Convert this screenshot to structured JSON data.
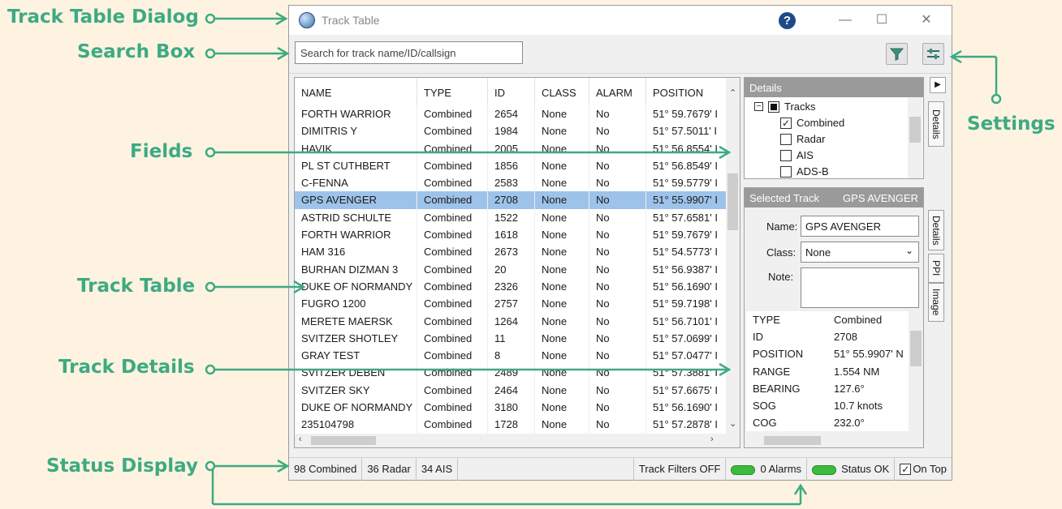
{
  "annotations": {
    "track_table_dialog": "Track Table Dialog",
    "search_box": "Search Box",
    "fields": "Fields",
    "track_table": "Track Table",
    "track_details": "Track Details",
    "status_display": "Status Display",
    "settings": "Settings"
  },
  "window": {
    "title": "Track Table",
    "help": "?",
    "minimize": "—",
    "maximize": "☐",
    "close": "✕"
  },
  "search": {
    "placeholder": "Search for track name/ID/callsign"
  },
  "table": {
    "columns": [
      "NAME",
      "TYPE",
      "ID",
      "CLASS",
      "ALARM",
      "POSITION"
    ],
    "rows": [
      [
        "FORTH WARRIOR",
        "Combined",
        "2654",
        "None",
        "No",
        "51° 59.7679' I"
      ],
      [
        "DIMITRIS Y",
        "Combined",
        "1984",
        "None",
        "No",
        "51° 57.5011' I"
      ],
      [
        "HAVIK",
        "Combined",
        "2005",
        "None",
        "No",
        "51° 56.8554' I"
      ],
      [
        "PL ST CUTHBERT",
        "Combined",
        "1856",
        "None",
        "No",
        "51° 56.8549' I"
      ],
      [
        "C-FENNA",
        "Combined",
        "2583",
        "None",
        "No",
        "51° 59.5779' I"
      ],
      [
        "GPS AVENGER",
        "Combined",
        "2708",
        "None",
        "No",
        "51° 55.9907' I"
      ],
      [
        "ASTRID SCHULTE",
        "Combined",
        "1522",
        "None",
        "No",
        "51° 57.6581' I"
      ],
      [
        "FORTH WARRIOR",
        "Combined",
        "1618",
        "None",
        "No",
        "51° 59.7679' I"
      ],
      [
        "HAM 316",
        "Combined",
        "2673",
        "None",
        "No",
        "51° 54.5773' I"
      ],
      [
        "BURHAN DIZMAN 3",
        "Combined",
        "20",
        "None",
        "No",
        "51° 56.9387' I"
      ],
      [
        "DUKE OF NORMANDY",
        "Combined",
        "2326",
        "None",
        "No",
        "51° 56.1690' I"
      ],
      [
        "FUGRO 1200",
        "Combined",
        "2757",
        "None",
        "No",
        "51° 59.7198' I"
      ],
      [
        "MERETE MAERSK",
        "Combined",
        "1264",
        "None",
        "No",
        "51° 56.7101' I"
      ],
      [
        "SVITZER SHOTLEY",
        "Combined",
        "11",
        "None",
        "No",
        "51° 57.0699' I"
      ],
      [
        "GRAY TEST",
        "Combined",
        "8",
        "None",
        "No",
        "51° 57.0477' I"
      ],
      [
        "SVITZER DEBEN",
        "Combined",
        "2489",
        "None",
        "No",
        "51° 57.3881' I"
      ],
      [
        "SVITZER SKY",
        "Combined",
        "2464",
        "None",
        "No",
        "51° 57.6675' I"
      ],
      [
        "DUKE OF NORMANDY",
        "Combined",
        "3180",
        "None",
        "No",
        "51° 56.1690' I"
      ],
      [
        "235104798",
        "Combined",
        "1728",
        "None",
        "No",
        "51° 57.2878' I"
      ]
    ],
    "selected_index": 5
  },
  "details_panel": {
    "header": "Details",
    "tree_root": "Tracks",
    "items": [
      {
        "label": "Combined",
        "checked": true
      },
      {
        "label": "Radar",
        "checked": false
      },
      {
        "label": "AIS",
        "checked": false
      },
      {
        "label": "ADS-B",
        "checked": false
      }
    ],
    "side_tab": "Details"
  },
  "selected_track": {
    "header_label": "Selected Track",
    "header_value": "GPS AVENGER",
    "name_label": "Name:",
    "name_value": "GPS AVENGER",
    "class_label": "Class:",
    "class_value": "None",
    "note_label": "Note:",
    "side_tabs": [
      "Details",
      "PPI",
      "Image"
    ],
    "properties": [
      [
        "TYPE",
        "Combined"
      ],
      [
        "ID",
        "2708"
      ],
      [
        "POSITION",
        "51° 55.9907' N"
      ],
      [
        "RANGE",
        "1.554 NM"
      ],
      [
        "BEARING",
        "127.6°"
      ],
      [
        "SOG",
        "10.7 knots"
      ],
      [
        "COG",
        "232.0°"
      ]
    ]
  },
  "status": {
    "combined": "98 Combined",
    "radar": "36 Radar",
    "ais": "34 AIS",
    "filters": "Track Filters OFF",
    "alarms": "0 Alarms",
    "status_ok": "Status OK",
    "on_top": "On Top"
  },
  "colors": {
    "annotation": "#3daa83",
    "selected_row": "#9ec3ea",
    "background": "#fdf3e0"
  }
}
